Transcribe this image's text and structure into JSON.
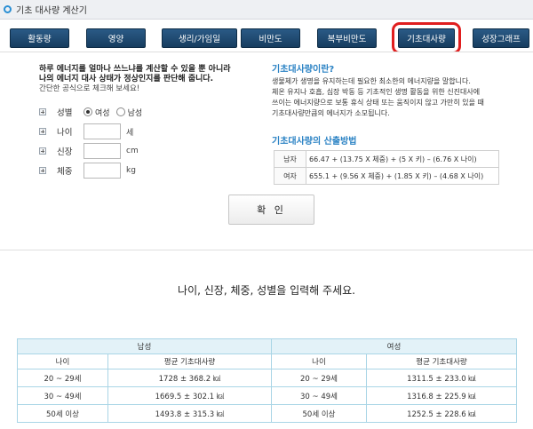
{
  "window": {
    "title": "기초 대사량 계산기"
  },
  "tabs": [
    {
      "label": "활동량"
    },
    {
      "label": "영양"
    },
    {
      "label": "생리/가임일"
    },
    {
      "label": "비만도"
    },
    {
      "label": "복부비만도"
    },
    {
      "label": "기초대사량"
    },
    {
      "label": "성장그래프"
    }
  ],
  "intro": {
    "line1": "하루 에너지를 얼마나 쓰느냐를 계산할 수 있을 뿐 아니라",
    "line2": "나의 에너지 대사 상태가 정상인지를 판단해 줍니다.",
    "line3": "간단한 공식으로 체크해 보세요!"
  },
  "form": {
    "gender_label": "성별",
    "female": "여성",
    "male": "남성",
    "age_label": "나이",
    "age_unit": "세",
    "height_label": "신장",
    "height_unit": "cm",
    "weight_label": "체중",
    "weight_unit": "kg"
  },
  "definition": {
    "title": "기초대사량이란?",
    "lines": [
      "생물체가 생명을 유지하는데 필요한 최소한의 에너지량을 말합니다.",
      "체온 유지나 호흡, 심장 박동 등 기초적인 생명 활동을 위한 신진대사에",
      "쓰이는 에너지량으로 보통 휴식 상태 또는 움직이지 않고 가만히 있을 때",
      "기초대사량만큼의 에너지가 소모됩니다."
    ]
  },
  "method": {
    "title": "기초대사량의 산출방법",
    "rows": [
      {
        "gender": "남자",
        "formula": "66.47 + (13.75 X 체중) + (5 X 키) – (6.76 X 나이)"
      },
      {
        "gender": "여자",
        "formula": "655.1 + (9.56 X 체중) + (1.85 X 키) – (4.68 X 나이)"
      }
    ]
  },
  "confirm_label": "확 인",
  "prompt": "나이, 신장, 체중, 성별을 입력해 주세요.",
  "stats": {
    "male": "남성",
    "female": "여성",
    "age_col": "나이",
    "avg_col": "평균 기초대사량",
    "rows": [
      {
        "m_age": "20 ~ 29세",
        "m_avg": "1728 ± 368.2 ㎉",
        "f_age": "20 ~ 29세",
        "f_avg": "1311.5 ± 233.0 ㎉"
      },
      {
        "m_age": "30 ~ 49세",
        "m_avg": "1669.5 ± 302.1 ㎉",
        "f_age": "30 ~ 49세",
        "f_avg": "1316.8 ± 225.9 ㎉"
      },
      {
        "m_age": "50세 이상",
        "m_avg": "1493.8 ± 315.3 ㎉",
        "f_age": "50세 이상",
        "f_avg": "1252.5 ± 228.6 ㎉"
      }
    ]
  },
  "colors": {
    "tab": "#1f4a70",
    "highlight": "#e01e1e",
    "accent_title": "#2a82c4",
    "table_border": "#a9d5e6"
  }
}
